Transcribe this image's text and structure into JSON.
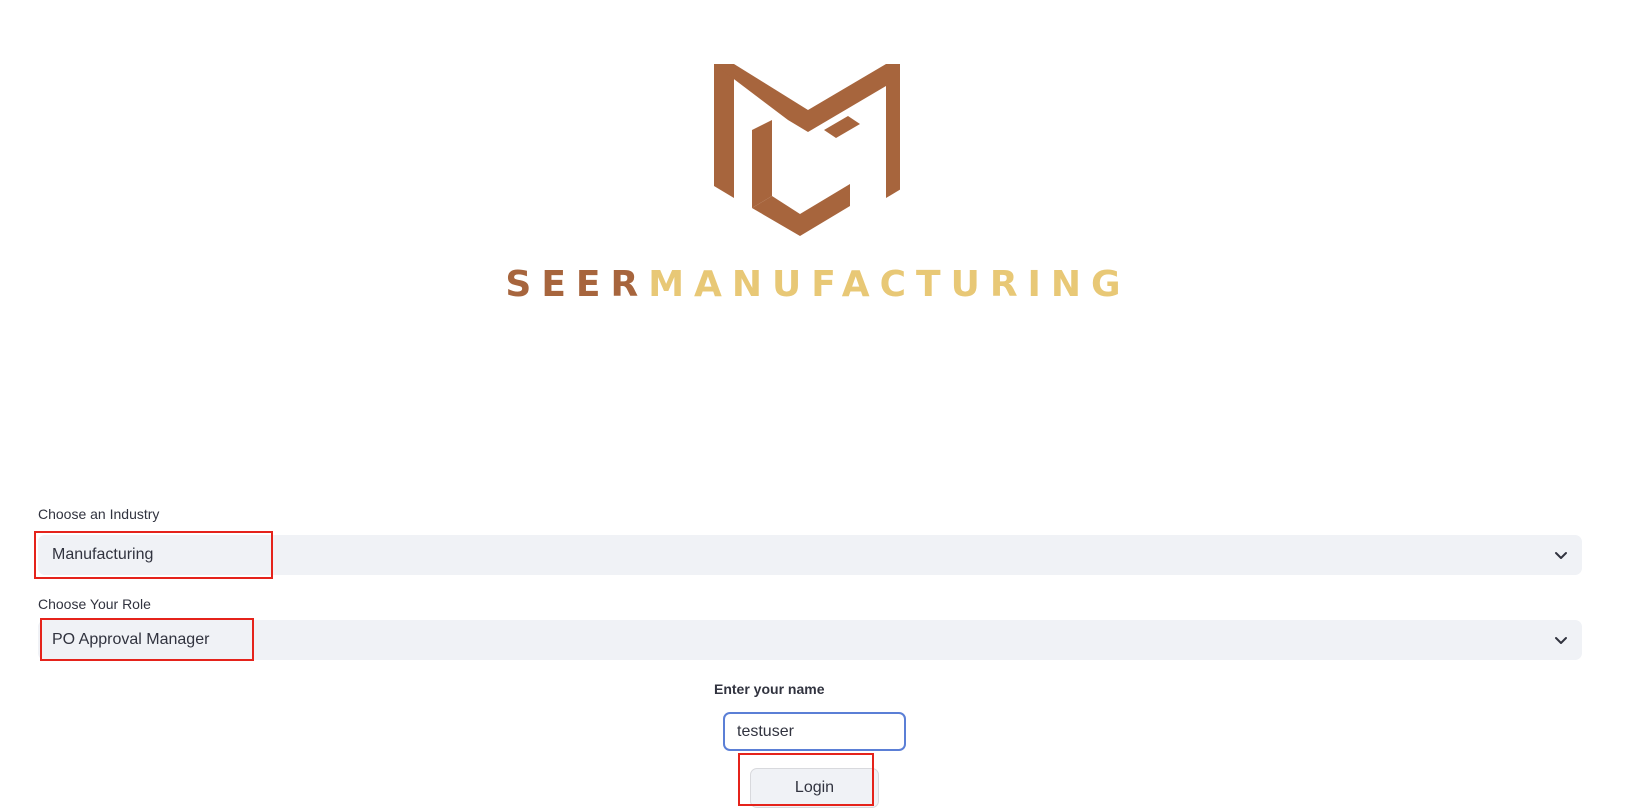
{
  "brand": {
    "name_part1": "SEER",
    "name_part2": "MANUFACTURING",
    "logo_icon": "seer-manufacturing-logo",
    "colors": {
      "primary": "#a7653d",
      "secondary": "#e8c876"
    }
  },
  "form": {
    "industry": {
      "label": "Choose an Industry",
      "selected": "Manufacturing",
      "icon": "chevron-down-icon"
    },
    "role": {
      "label": "Choose Your Role",
      "selected": "PO Approval Manager",
      "icon": "chevron-down-icon"
    },
    "name": {
      "label": "Enter your name",
      "value": "testuser"
    },
    "login_label": "Login"
  },
  "annotation_color": "#e5231b"
}
